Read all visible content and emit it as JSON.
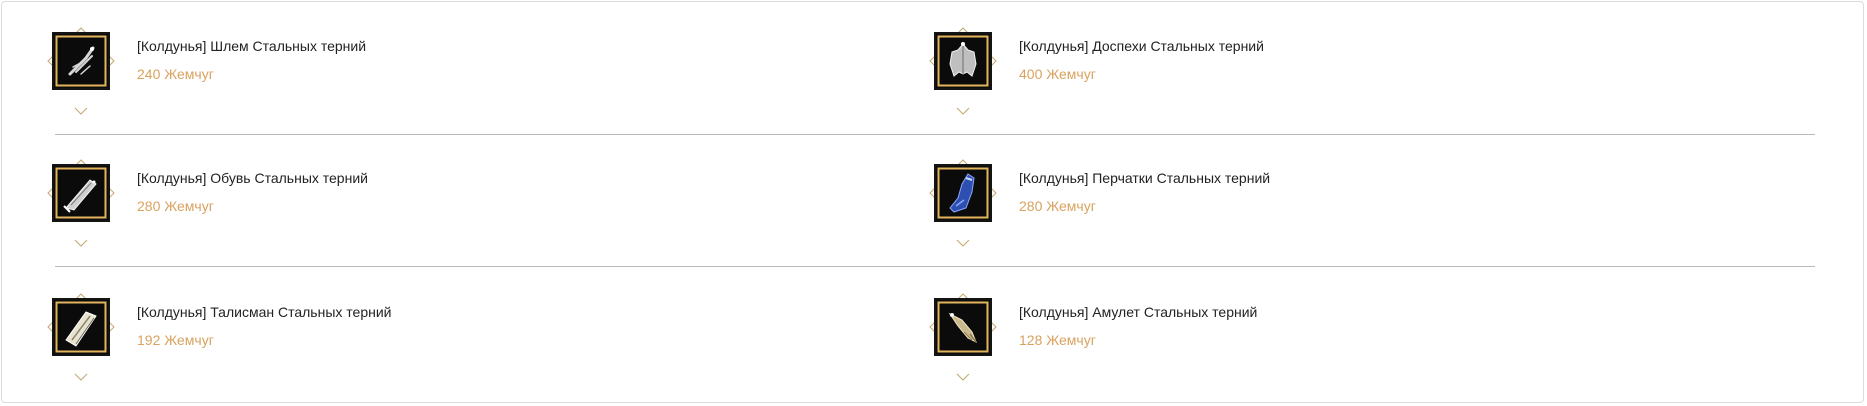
{
  "items": [
    {
      "name": "[Колдунья] Шлем Стальных терний",
      "price": "240 Жемчуг",
      "icon": "helm-icon"
    },
    {
      "name": "[Колдунья] Доспехи Стальных терний",
      "price": "400 Жемчуг",
      "icon": "armor-icon"
    },
    {
      "name": "[Колдунья] Обувь Стальных терний",
      "price": "280 Жемчуг",
      "icon": "boots-icon"
    },
    {
      "name": "[Колдунья] Перчатки Стальных терний",
      "price": "280 Жемчуг",
      "icon": "gloves-icon"
    },
    {
      "name": "[Колдунья] Талисман Стальных терний",
      "price": "192 Жемчуг",
      "icon": "talisman-icon"
    },
    {
      "name": "[Колдунья] Амулет Стальных терний",
      "price": "128 Жемчуг",
      "icon": "amulet-icon"
    }
  ],
  "colors": {
    "price": "#d9a25f",
    "frame_gold": "#e2b45c",
    "frame_bg": "#0b0b0b",
    "divider": "#b9b9b9"
  }
}
